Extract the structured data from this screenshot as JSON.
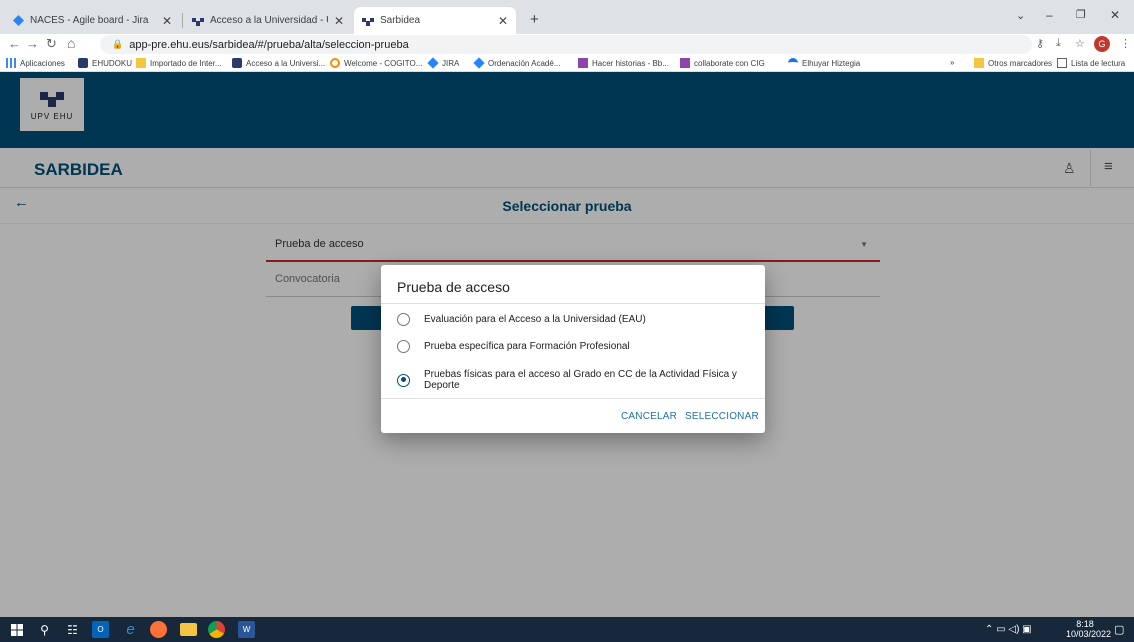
{
  "browser": {
    "tabs": [
      {
        "title": "NACES - Agile board - Jira",
        "icon": "jira-icon",
        "active": false
      },
      {
        "title": "Acceso a la Universidad - UPV/EHU",
        "icon": "upv-icon",
        "active": false
      },
      {
        "title": "Sarbidea",
        "icon": "upv-icon",
        "active": true
      }
    ],
    "new_tab_label": "+",
    "url": "app-pre.ehu.eus/sarbidea/#/prueba/alta/seleccion-prueba",
    "profile_initial": "G",
    "bookmarks": [
      "Aplicaciones",
      "EHUDOKU",
      "Importado de Inter...",
      "Acceso a la Universi...",
      "Welcome - COGITO...",
      "JIRA",
      "Ordenación Acadé...",
      "Hacer historias - Bb...",
      "collaborate con CIG",
      "Elhuyar Hiztegia",
      "»",
      "Otros marcadores",
      "Lista de lectura"
    ]
  },
  "app": {
    "logo_text": "UPV   EHU",
    "title": "SARBIDEA",
    "page_title": "Seleccionar prueba",
    "fields": {
      "prueba_label": "Prueba de acceso",
      "convocatoria_label": "Convocatoria"
    }
  },
  "dialog": {
    "title": "Prueba de acceso",
    "options": [
      {
        "label": "Evaluación para el Acceso a la Universidad (EAU)",
        "selected": false
      },
      {
        "label": "Prueba específica para Formación Profesional",
        "selected": false
      },
      {
        "label": "Pruebas físicas para el acceso al Grado en CC de la Actividad Física y Deporte",
        "selected": true
      }
    ],
    "cancel_label": "CANCELAR",
    "select_label": "SELECCIONAR"
  },
  "taskbar": {
    "time": "8:18",
    "date": "10/03/2022"
  },
  "colors": {
    "brand": "#01507a",
    "accent_red": "#c62828",
    "link": "#1f6fa8"
  }
}
